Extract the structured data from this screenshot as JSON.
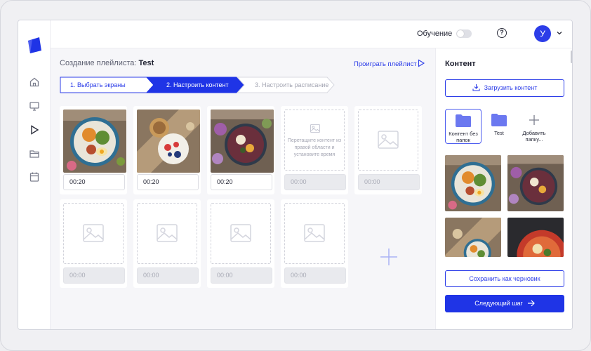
{
  "header": {
    "learning_label": "Обучение",
    "help_glyph": "?",
    "avatar_initial": "У"
  },
  "main": {
    "title_prefix": "Создание плейлиста:",
    "playlist_name": "Test",
    "play_link": "Проиграть плейлист",
    "steps": [
      {
        "label": "1. Выбрать экраны",
        "state": "done"
      },
      {
        "label": "2. Настроить контент",
        "state": "active"
      },
      {
        "label": "3. Настроить расписание",
        "state": "upcoming"
      }
    ],
    "drop_hint": "Перетащите контент из правой области и установите время",
    "tiles": [
      {
        "type": "photo",
        "time": "00:20"
      },
      {
        "type": "photo",
        "time": "00:20"
      },
      {
        "type": "photo",
        "time": "00:20"
      },
      {
        "type": "drop",
        "time": "00:00"
      },
      {
        "type": "empty",
        "time": "00:00"
      },
      {
        "type": "empty",
        "time": "00:00"
      },
      {
        "type": "empty",
        "time": "00:00"
      },
      {
        "type": "empty",
        "time": "00:00"
      },
      {
        "type": "empty",
        "time": "00:00"
      }
    ]
  },
  "panel": {
    "title": "Контент",
    "upload_label": "Загрузить контент",
    "folders": [
      {
        "label": "Контент без папок",
        "selected": true
      },
      {
        "label": "Test",
        "selected": false
      },
      {
        "label": "Добавить папку...",
        "selected": false
      }
    ],
    "save_label": "Сохранить как черновик",
    "next_label": "Следующий шаг"
  },
  "colors": {
    "accent": "#2c3de8",
    "folder": "#6b78f0",
    "step_active": "#1f34e6"
  }
}
